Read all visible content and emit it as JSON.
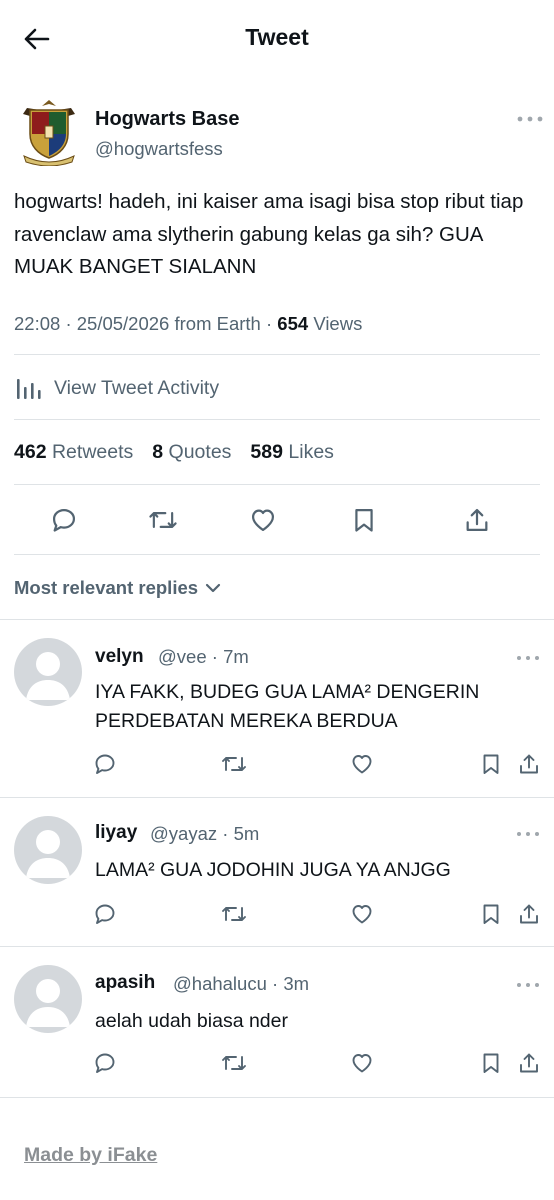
{
  "header": {
    "title": "Tweet",
    "back_icon": "arrow-left-icon"
  },
  "tweet": {
    "author_name": "Hogwarts Base",
    "author_handle": "@hogwartsfess",
    "text": "hogwarts! hadeh, ini kaiser ama isagi bisa stop ribut tiap ravenclaw ama slytherin gabung kelas ga sih? GUA MUAK BANGET SIALANN",
    "time": "22:08",
    "date": "25/05/2026",
    "source": "from Earth",
    "views_count": "654",
    "views_label": "Views",
    "activity_label": "View Tweet Activity",
    "retweets_count": "462",
    "retweets_label": "Retweets",
    "quotes_count": "8",
    "quotes_label": "Quotes",
    "likes_count": "589",
    "likes_label": "Likes"
  },
  "replies_filter": {
    "label": "Most relevant replies"
  },
  "replies": [
    {
      "name": "velyn",
      "handle": "@vee",
      "time": "7m",
      "line1": "IYA FAKK, BUDEG GUA LAMA² DENGERIN",
      "line2": "PERDEBATAN MEREKA BERDUA"
    },
    {
      "name": "liyay",
      "handle": "@yayaz",
      "time": "5m",
      "line1": "LAMA² GUA JODOHIN JUGA YA ANJGG",
      "line2": ""
    },
    {
      "name": "apasih",
      "handle": "@hahalucu",
      "time": "3m",
      "line1": "aelah udah biasa nder",
      "line2": ""
    }
  ],
  "footer": {
    "watermark": "Made by iFake"
  },
  "colors": {
    "text": "#0f1419",
    "secondary": "#536471",
    "divider": "#dfe3e6",
    "placeholder_avatar": "#d4d8dc"
  }
}
